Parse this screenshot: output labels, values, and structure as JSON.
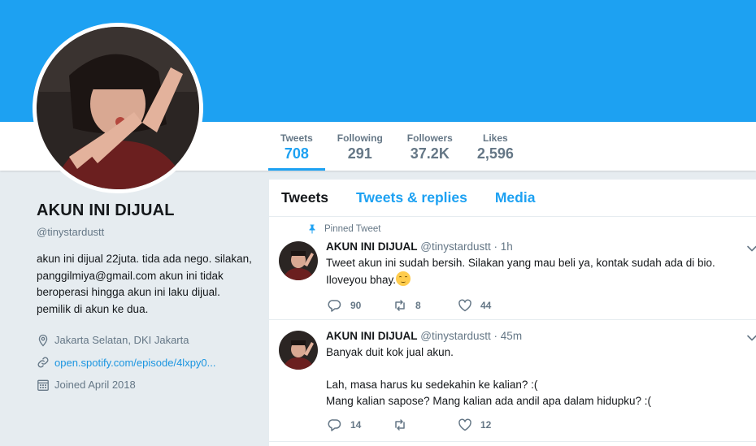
{
  "profile": {
    "name": "AKUN INI DIJUAL",
    "handle": "@tinystardustt",
    "bio": "akun ini dijual 22juta. tida ada nego. silakan, panggilmiya@gmail.com akun ini tidak beroperasi hingga akun ini laku dijual. pemilik di akun ke dua.",
    "location": "Jakarta Selatan, DKI Jakarta",
    "website": "open.spotify.com/episode/4lxpy0...",
    "joined": "Joined April 2018"
  },
  "stats": [
    {
      "label": "Tweets",
      "value": "708"
    },
    {
      "label": "Following",
      "value": "291"
    },
    {
      "label": "Followers",
      "value": "37.2K"
    },
    {
      "label": "Likes",
      "value": "2,596"
    }
  ],
  "tabs": [
    {
      "label": "Tweets"
    },
    {
      "label": "Tweets & replies"
    },
    {
      "label": "Media"
    }
  ],
  "tweets": [
    {
      "pinned_label": "Pinned Tweet",
      "name": "AKUN INI DIJUAL",
      "handle": "@tinystardustt",
      "time": "1h",
      "lines": [
        "Tweet akun ini sudah bersih. Silakan yang mau beli ya, kontak sudah ada di bio.",
        "Iloveyou bhay."
      ],
      "replies": "90",
      "retweets": "8",
      "likes": "44"
    },
    {
      "name": "AKUN INI DIJUAL",
      "handle": "@tinystardustt",
      "time": "45m",
      "lines": [
        "Banyak duit kok jual akun.",
        "",
        "Lah, masa harus ku sedekahin ke kalian? :(",
        "Mang kalian sapose? Mang kalian ada andil apa dalam hidupku? :("
      ],
      "replies": "14",
      "retweets": "",
      "likes": "12"
    }
  ],
  "colors": {
    "accent": "#1da1f2",
    "link": "#1b95e0",
    "muted": "#657786",
    "background": "#e6ecf0"
  }
}
